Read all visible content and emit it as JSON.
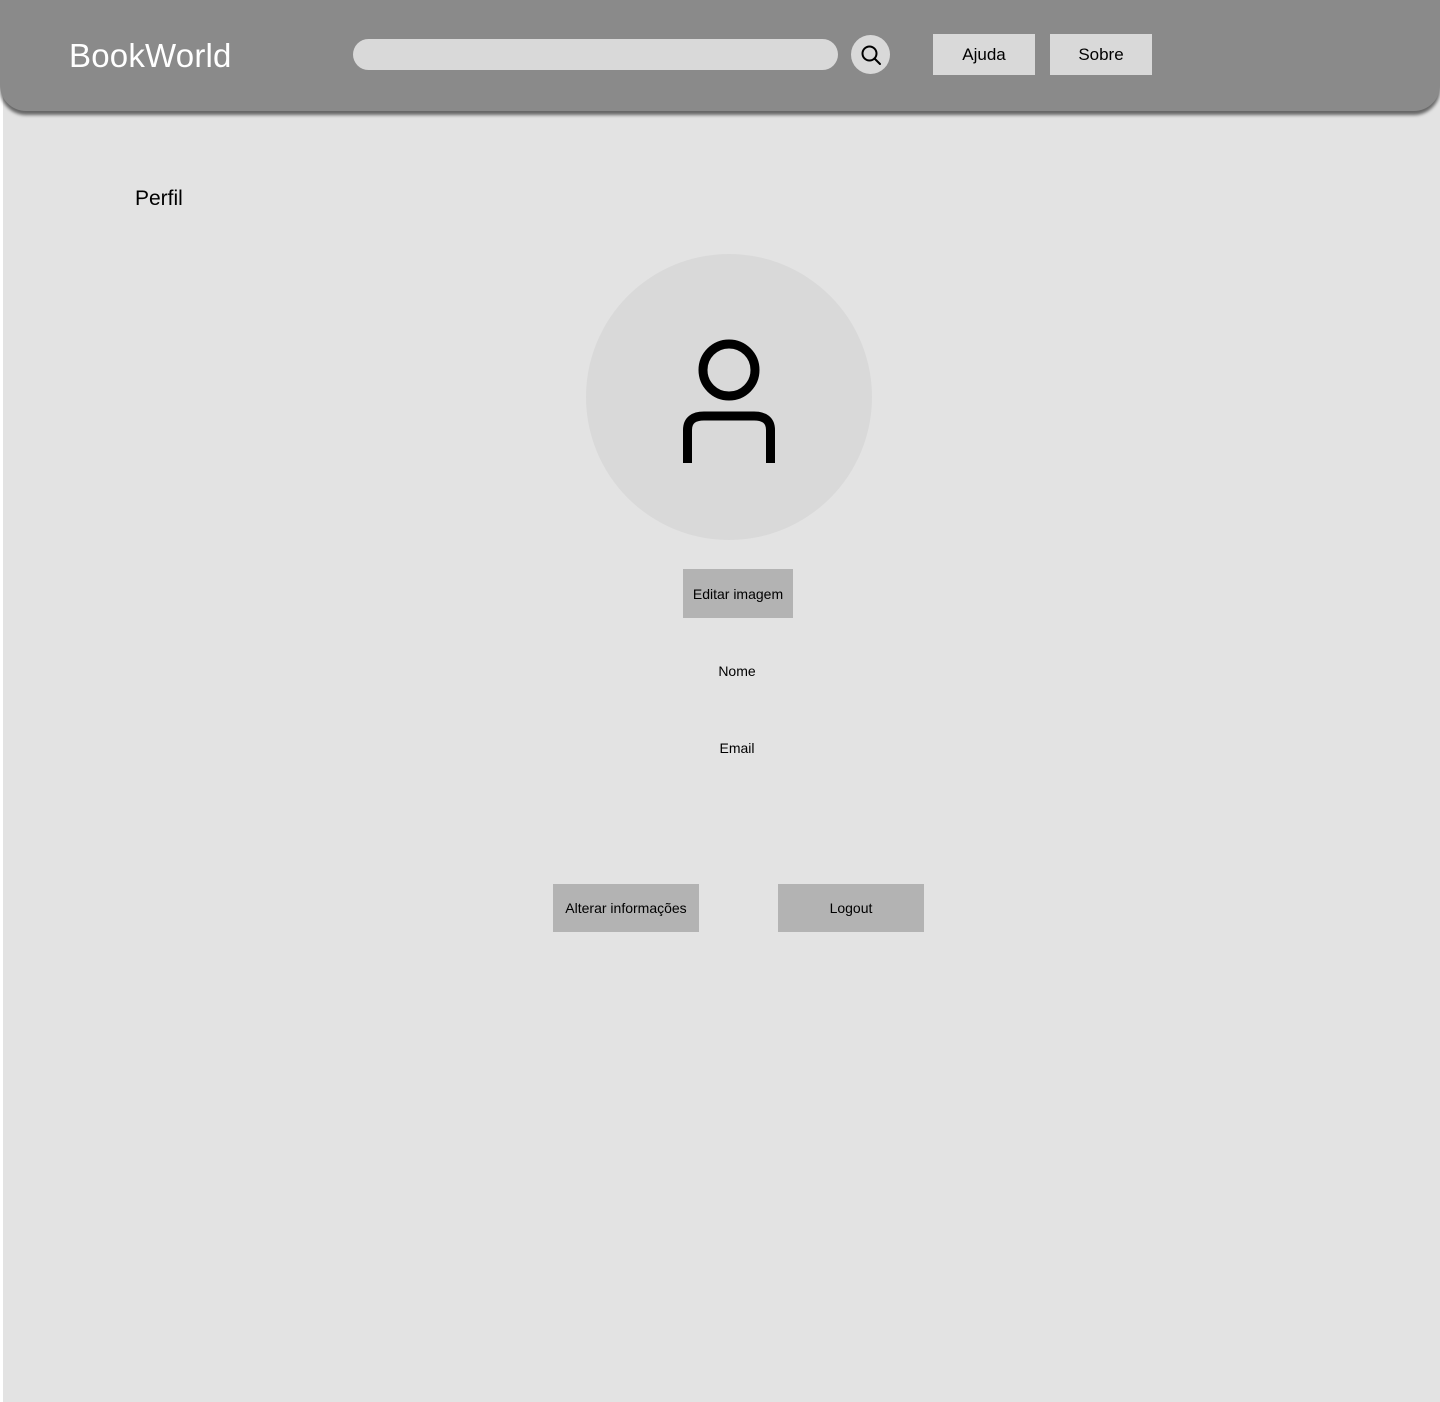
{
  "header": {
    "brand": "BookWorld",
    "search": {
      "value": "",
      "placeholder": "",
      "icon": "search-icon"
    },
    "nav": {
      "help_label": "Ajuda",
      "about_label": "Sobre"
    }
  },
  "profile": {
    "title": "Perfil",
    "avatar_icon": "user-icon",
    "edit_image_label": "Editar imagem",
    "name_label": "Nome",
    "email_label": "Email",
    "change_info_label": "Alterar informações",
    "logout_label": "Logout"
  },
  "colors": {
    "header_bg": "#8a8a8a",
    "page_bg": "#e3e3e3",
    "light_control": "#d9d9d9",
    "action_button": "#b3b3b3"
  }
}
